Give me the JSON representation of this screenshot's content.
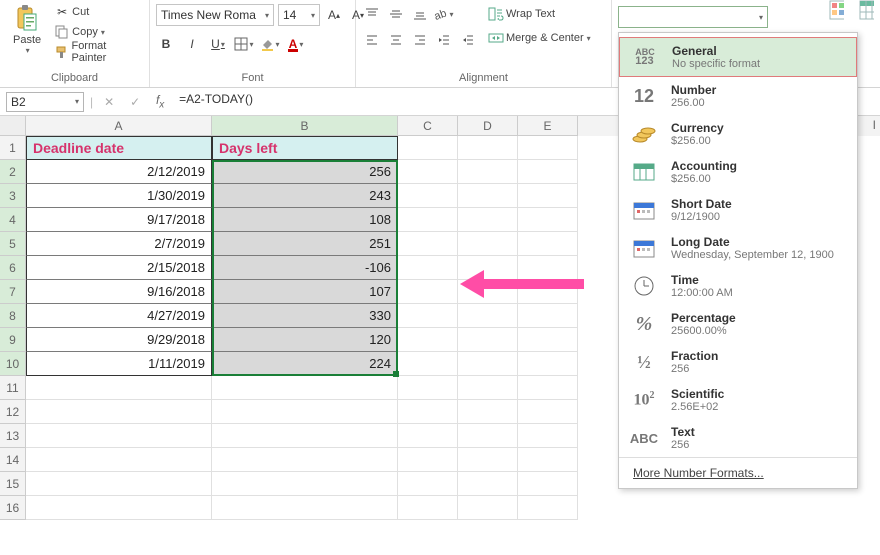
{
  "ribbon": {
    "clipboard": {
      "paste": "Paste",
      "cut": "Cut",
      "copy": "Copy",
      "format_painter": "Format Painter",
      "label": "Clipboard"
    },
    "font": {
      "name": "Times New Roma",
      "size": "14",
      "label": "Font"
    },
    "alignment": {
      "wrap": "Wrap Text",
      "merge": "Merge & Center",
      "label": "Alignment"
    }
  },
  "number_formats": {
    "more": "More Number Formats...",
    "items": [
      {
        "title": "General",
        "sub": "No specific format",
        "icon": "abc123"
      },
      {
        "title": "Number",
        "sub": "256.00",
        "icon": "12"
      },
      {
        "title": "Currency",
        "sub": "$256.00",
        "icon": "coins"
      },
      {
        "title": "Accounting",
        "sub": "$256.00",
        "icon": "ledger"
      },
      {
        "title": "Short Date",
        "sub": "9/12/1900",
        "icon": "cal"
      },
      {
        "title": "Long Date",
        "sub": "Wednesday, September 12, 1900",
        "icon": "cal"
      },
      {
        "title": "Time",
        "sub": "12:00:00 AM",
        "icon": "clock"
      },
      {
        "title": "Percentage",
        "sub": "25600.00%",
        "icon": "pct"
      },
      {
        "title": "Fraction",
        "sub": "256",
        "icon": "frac"
      },
      {
        "title": "Scientific",
        "sub": "2.56E+02",
        "icon": "sci"
      },
      {
        "title": "Text",
        "sub": "256",
        "icon": "abc"
      }
    ]
  },
  "name_box": "B2",
  "formula": "=A2-TODAY()",
  "columns": [
    "A",
    "B",
    "C",
    "D",
    "E"
  ],
  "header_row": {
    "A": "Deadline date",
    "B": "Days left"
  },
  "rows": [
    {
      "A": "2/12/2019",
      "B": "256"
    },
    {
      "A": "1/30/2019",
      "B": "243"
    },
    {
      "A": "9/17/2018",
      "B": "108"
    },
    {
      "A": "2/7/2019",
      "B": "251"
    },
    {
      "A": "2/15/2018",
      "B": "-106"
    },
    {
      "A": "9/16/2018",
      "B": "107"
    },
    {
      "A": "4/27/2019",
      "B": "330"
    },
    {
      "A": "9/29/2018",
      "B": "120"
    },
    {
      "A": "1/11/2019",
      "B": "224"
    }
  ],
  "visible_row_count": 16,
  "extra_col_letter": "I"
}
